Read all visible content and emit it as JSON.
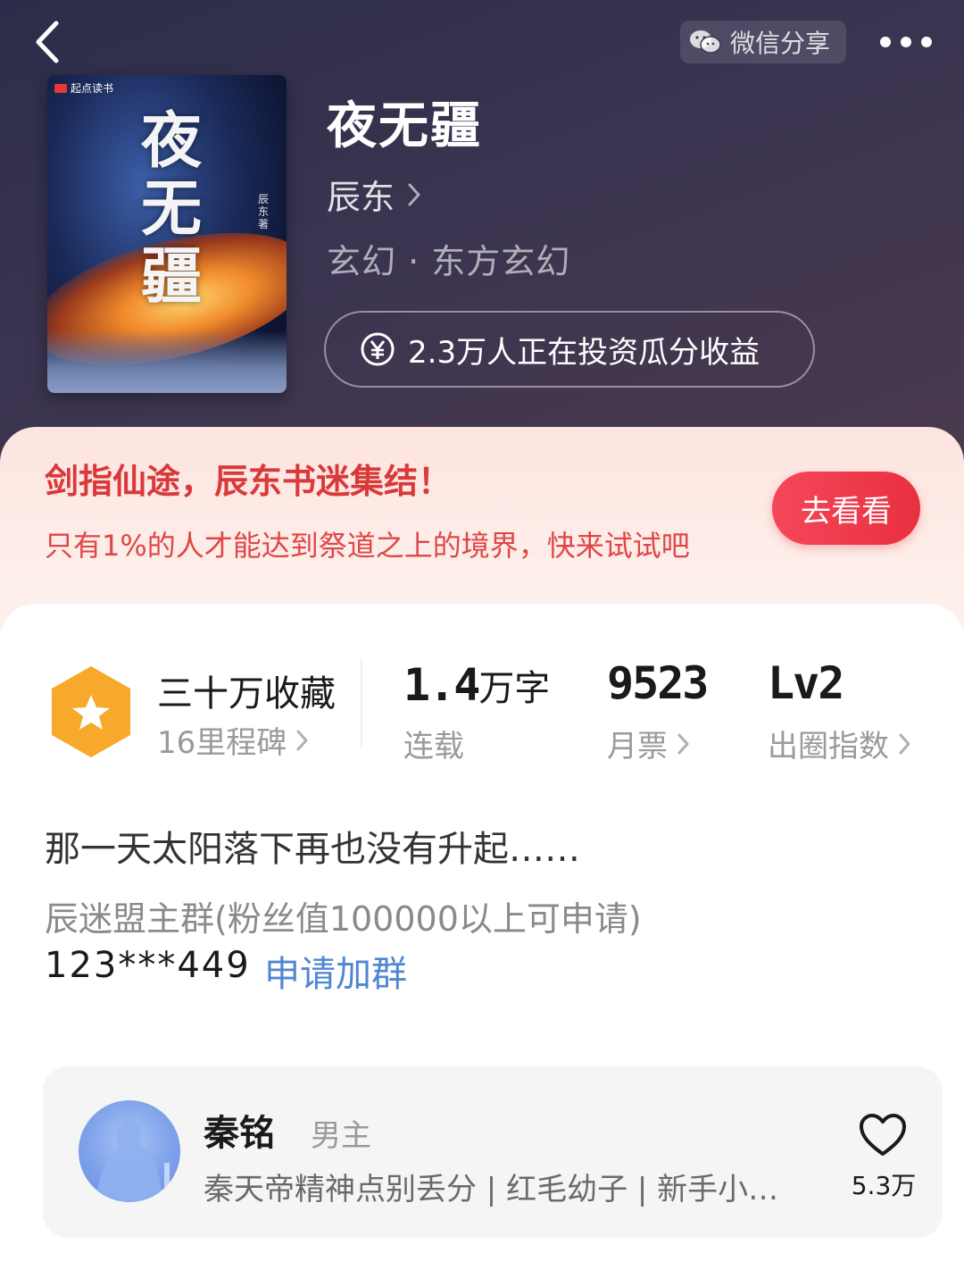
{
  "header": {
    "share_label": "微信分享",
    "back_icon": "chevron-left-icon",
    "more_icon": "more-dots-icon"
  },
  "book": {
    "cover_brand": "起点读书",
    "cover_title_chars": [
      "夜",
      "无",
      "疆"
    ],
    "cover_author": "辰东",
    "cover_author_suffix": "著",
    "title": "夜无疆",
    "author": "辰东",
    "genre": "玄幻 · 东方玄幻",
    "invest_text": "2.3万人正在投资瓜分收益"
  },
  "promo": {
    "title": "剑指仙途，辰东书迷集结！",
    "subtitle": "只有1%的人才能达到祭道之上的境界，快来试试吧",
    "button": "去看看"
  },
  "stats": {
    "favorites_label": "三十万收藏",
    "milestones": "16里程碑",
    "words_num": "1.4",
    "words_unit": "万字",
    "status": "连载",
    "monthly_votes": "9523",
    "monthly_votes_label": "月票",
    "level": "Lv2",
    "level_label": "出圈指数"
  },
  "intro": {
    "description": "那一天太阳落下再也没有升起……",
    "group_label": "辰迷盟主群(粉丝值100000以上可申请)",
    "group_number": "123***449",
    "group_join": "申请加群"
  },
  "character": {
    "name": "秦铭",
    "role": "男主",
    "tags": "秦天帝精神点别丢分 | 红毛幼子 | 新手小…",
    "likes": "5.3万"
  },
  "colors": {
    "hero_bg": "#2c2d4a",
    "promo_red": "#d9393a",
    "button_red": "#f5475a",
    "link_blue": "#4f86d0",
    "badge_orange": "#f7a92b"
  }
}
